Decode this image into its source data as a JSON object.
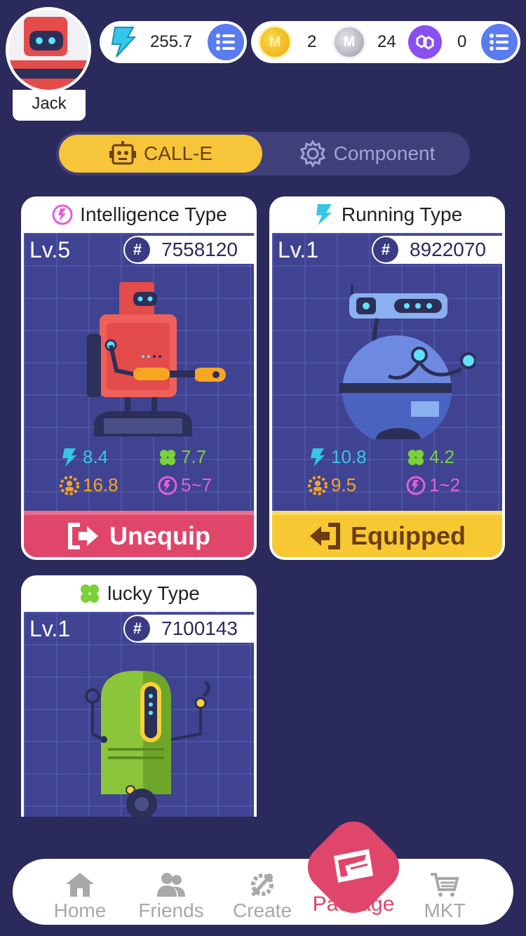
{
  "user": {
    "name": "Jack"
  },
  "currency": {
    "energy": "255.7",
    "gold": "2",
    "silver": "24",
    "polygon": "0",
    "gold_icon_letter": "M",
    "silver_icon_letter": "M"
  },
  "tabs": {
    "active": "CALL-E",
    "inactive": "Component"
  },
  "cards": [
    {
      "type": "Intelligence Type",
      "level": "Lv.5",
      "serial": "7558120",
      "stats": {
        "speed": "8.4",
        "luck": "7.7",
        "power": "16.8",
        "intel": "5~7"
      },
      "button": "Unequip",
      "button_style": "unequip"
    },
    {
      "type": "Running Type",
      "level": "Lv.1",
      "serial": "8922070",
      "stats": {
        "speed": "10.8",
        "luck": "4.2",
        "power": "9.5",
        "intel": "1~2"
      },
      "button": "Equipped",
      "button_style": "equipped"
    },
    {
      "type": "lucky Type",
      "level": "Lv.1",
      "serial": "7100143"
    }
  ],
  "serial_symbol": "#",
  "nav": {
    "home": "Home",
    "friends": "Friends",
    "create": "Create",
    "package": "Package",
    "mkt": "MKT"
  },
  "colors": {
    "background": "#2b2a5c",
    "accent_yellow": "#f6c53a",
    "accent_pink": "#e0456a",
    "accent_blue": "#5b7bf0",
    "speed_cyan": "#35c6e8",
    "luck_green": "#7ad13a",
    "power_orange": "#f6a623",
    "intel_pink": "#e060d8"
  }
}
